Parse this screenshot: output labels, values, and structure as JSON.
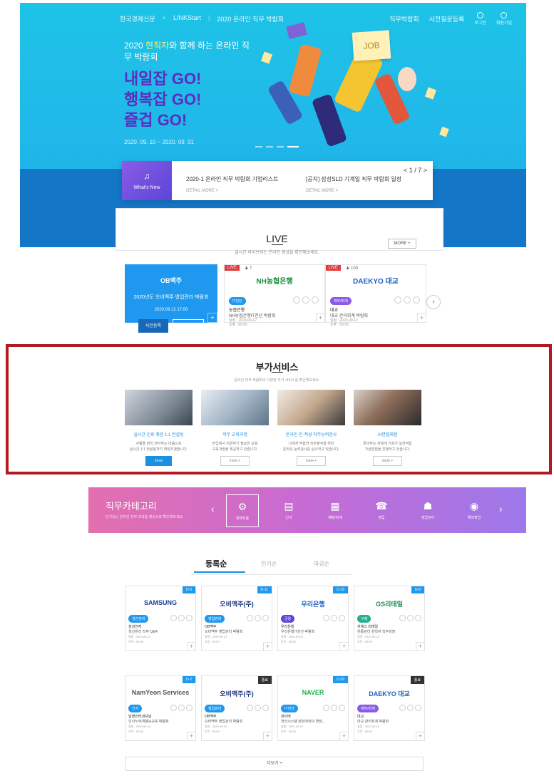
{
  "header": {
    "brand": [
      "한국경제신문",
      "LINKStart",
      "2020 온라인 직무 박람회"
    ],
    "menus": [
      "직무박람회",
      "사전질문등록"
    ],
    "icons": [
      {
        "label": "로그인",
        "icon": "login-icon"
      },
      {
        "label": "회원가입",
        "icon": "signup-icon"
      }
    ]
  },
  "hero": {
    "sub_before": "2020 ",
    "sub_highlight": "현직자",
    "sub_after": "와 함께 하는 온라인 직무 박람회",
    "lines": [
      "내일잡 GO!",
      "행복잡 GO!",
      "즐겁 GO!"
    ],
    "date": "2020. 09. 10 ~ 2020. 09. 01",
    "job_card": "JOB"
  },
  "notice": {
    "whatsnew": "What's New",
    "items": [
      {
        "title": "2020-1 온라인 직무 박람회 기업리스트",
        "more": "DETAIL MORE >"
      },
      {
        "title": "[공지] 삼성SLD 기계일 직무 박람회 일정",
        "more": "DETAIL MORE >"
      }
    ],
    "pager": "< 1 / 7 >"
  },
  "live": {
    "title": "LIVE",
    "desc": "실시간 라이브되는 온라인 영상을 확인해보세요.",
    "more": "MORE +",
    "featured": {
      "company": "OB맥주",
      "title": "2020년도 오비맥주 영업관리 박람회",
      "time": "2020.09.12    17:00",
      "btn1": "사전등록",
      "btn2": "지금참여"
    },
    "cards": [
      {
        "badge": "LIVE",
        "count": "7",
        "logo": "NH농협은행",
        "pill": "IT전산",
        "company": "농협은행",
        "title": "NH농협은행IT전산 박람회",
        "date": "일정 : 2020-09-12",
        "time": "오후 : 00:00"
      },
      {
        "badge": "LIVE",
        "count": "100",
        "logo": "DAEKYO 대교",
        "pill": "재무/회계",
        "company": "대교",
        "title": "대교 관리회계 박람회",
        "date": "일정 : 2020-09-12",
        "time": "오후 : 00:00"
      }
    ]
  },
  "services": {
    "title": "부가서비스",
    "desc": "온라인 직무 박람회의 다양한 추가 서비스를 확인해보세요.",
    "items": [
      {
        "name": "실시간 진로 취업 1:1 컨설팅",
        "desc1": "사람들 현직 생각하는 마음으로",
        "desc2": "실시간 1:1 컨설팅까지 책임지겠습니다.",
        "btn": "more"
      },
      {
        "name": "직무 교육과정",
        "desc1": "현업에서 지원하기 필요한 교육",
        "desc2": "교육과정을 제공하고 있습니다.",
        "btn": "more +"
      },
      {
        "name": "온라인 인·적성 직무능력검사",
        "desc1": "나에게 적합한 직무분석을 위한",
        "desc2": "온라인 능력검사를 실시하고 있습니다.",
        "btn": "more +"
      },
      {
        "name": "AI면접체험",
        "desc1": "준비하는 자에게 기회가 실전적합",
        "desc2": "가상면접을 진행하고 있습니다.",
        "btn": "more +"
      }
    ]
  },
  "category": {
    "title": "직무카테고리",
    "sub": "인기있는 온라인 직무 교육을 영상으로 확인해보세요.",
    "items": [
      {
        "label": "전체직종",
        "icon": "all-jobs-icon",
        "glyph": "⚙"
      },
      {
        "label": "인사",
        "icon": "hr-icon",
        "glyph": "▤"
      },
      {
        "label": "재정/회계",
        "icon": "finance-icon",
        "glyph": "▦"
      },
      {
        "label": "영업",
        "icon": "sales-icon",
        "glyph": "☎"
      },
      {
        "label": "영업관리",
        "icon": "sales-mgmt-icon",
        "glyph": "☗"
      },
      {
        "label": "해외영업",
        "icon": "global-sales-icon",
        "glyph": "◉"
      }
    ]
  },
  "tabs": {
    "items": [
      "등록순",
      "인기순",
      "마감순"
    ],
    "active": 0
  },
  "cards": [
    {
      "badge": "D-3",
      "badge_color": "#1e99ef",
      "logo": "SAMSUNG",
      "logo_color": "#1b3f9a",
      "pill": "생산관리",
      "pill_color": "#1e99ef",
      "company": "삼성전자",
      "title": "생산관리 직무 Q&A",
      "date": "일정 : 2020-09-12",
      "time": "오후 : 00:00"
    },
    {
      "badge": "D-11",
      "badge_color": "#1e99ef",
      "logo": "오비맥주(주)",
      "logo_color": "#17347d",
      "pill": "영업관리",
      "pill_color": "#1e99ef",
      "company": "OB맥주",
      "title": "오비맥주 영업관리 박람회",
      "date": "일정 : 2020-09-12",
      "time": "오후 : 00:00"
    },
    {
      "badge": "D-19",
      "badge_color": "#1e99ef",
      "logo": "우리은행",
      "logo_color": "#1b5fbf",
      "pill": "금융",
      "pill_color": "#5b46d9",
      "company": "우리은행",
      "title": "우리은행IT전산 박람회",
      "date": "일정 : 2020-09-12",
      "time": "오후 : 00:00"
    },
    {
      "badge": "D-8",
      "badge_color": "#1e99ef",
      "logo": "GS리테일",
      "logo_color": "#1f8a4c",
      "pill": "구매",
      "pill_color": "#24b08e",
      "company": "지에스 리테일",
      "title": "유통관리 현직자 직무상담",
      "date": "일정 : 2020-09-12",
      "time": "오후 : 00:00"
    },
    {
      "badge": "D-2",
      "badge_color": "#1e99ef",
      "logo": "NamYeon Services",
      "logo_color": "#555555",
      "pill": "인사",
      "pill_color": "#1e99ef",
      "company": "남영인터내셔널",
      "title": "인사노무/채용&교육 박람회",
      "date": "일정 : 2020-09-12",
      "time": "오후 : 00:00"
    },
    {
      "badge": "종료",
      "badge_color": "#333333",
      "logo": "오비맥주(주)",
      "logo_color": "#17347d",
      "pill": "영업관리",
      "pill_color": "#1e99ef",
      "company": "OB맥주",
      "title": "오비맥주 영업관리 박람회",
      "date": "일정 : 2020-09-12",
      "time": "오후 : 00:00"
    },
    {
      "badge": "D-29",
      "badge_color": "#1e99ef",
      "logo": "NAVER",
      "logo_color": "#17b34a",
      "pill": "IT전산",
      "pill_color": "#1e99ef",
      "company": "네이버",
      "title": "전산시스템 담당자와의 면담...",
      "date": "일정 : 2020-09-12",
      "time": "오후 : 00:00"
    },
    {
      "badge": "종료",
      "badge_color": "#333333",
      "logo": "DAEKYO 대교",
      "logo_color": "#1b5fbf",
      "pill": "재무/회계",
      "pill_color": "#8a5be6",
      "company": "대교",
      "title": "대교 관리회계 박람회",
      "date": "일정 : 2020-09-12",
      "time": "오후 : 00:00"
    }
  ],
  "more_bottom": "더보기 +"
}
